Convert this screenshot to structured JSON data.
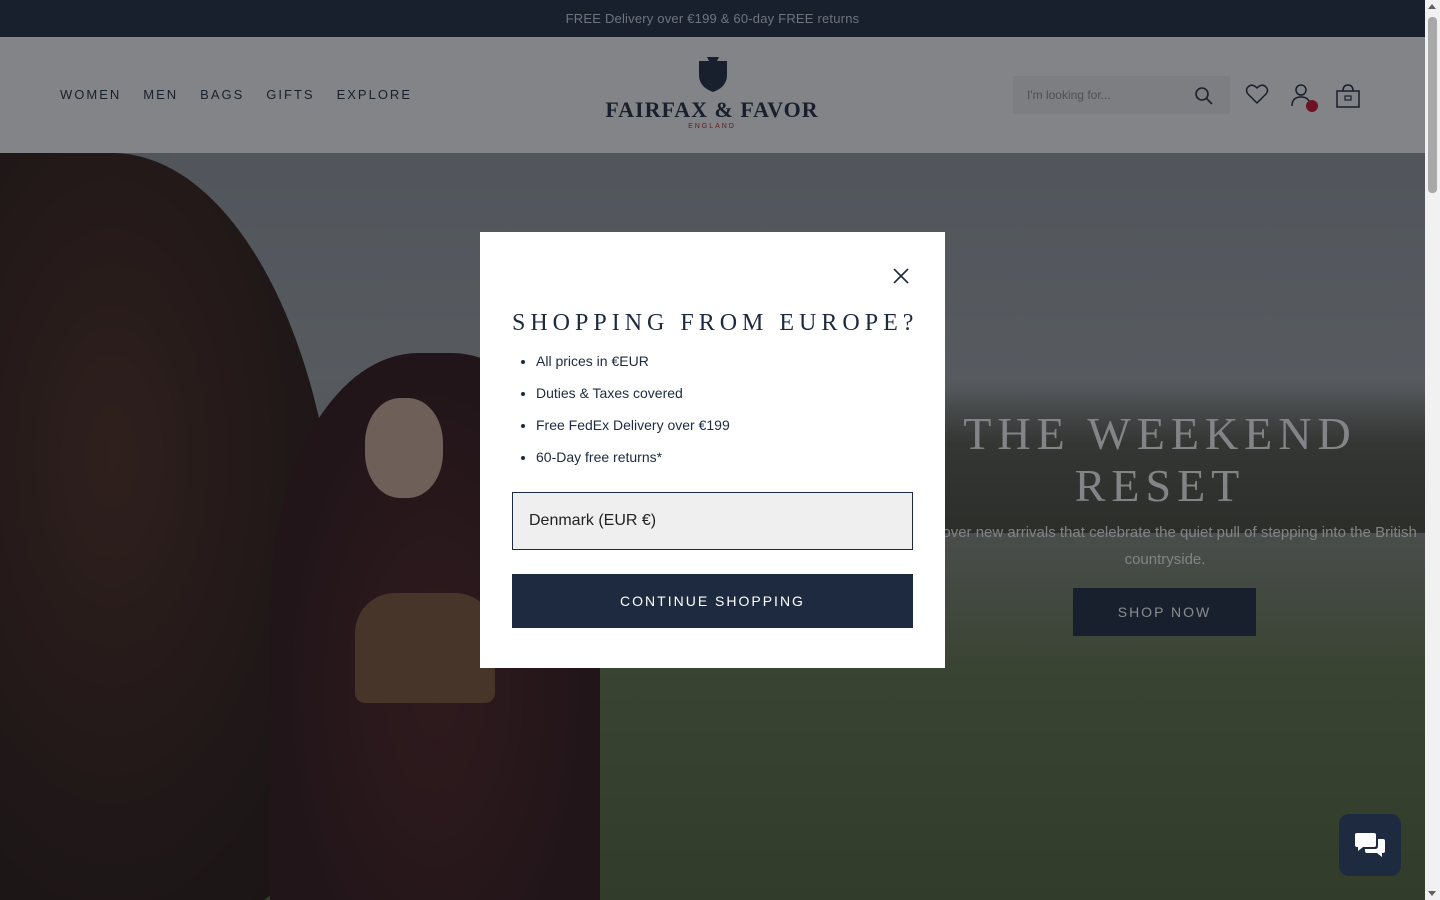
{
  "announcement": {
    "text": "FREE Delivery over €199 & 60-day FREE returns"
  },
  "header": {
    "nav": [
      "WOMEN",
      "MEN",
      "BAGS",
      "GIFTS",
      "EXPLORE"
    ],
    "logo": {
      "name": "FAIRFAX & FAVOR",
      "sub": "ENGLAND"
    },
    "search": {
      "placeholder": "I'm looking for..."
    },
    "icons": [
      "search-icon",
      "heart-icon",
      "account-icon",
      "bag-icon"
    ],
    "account_badge_color": "#c8102e"
  },
  "hero": {
    "title": "THE WEEKEND RESET",
    "subtitle": "Discover new arrivals that celebrate the quiet pull of stepping into the British countryside.",
    "cta": "SHOP NOW"
  },
  "modal": {
    "title": "SHOPPING FROM EUROPE?",
    "bullets": [
      "All prices in €EUR",
      "Duties & Taxes covered",
      "Free FedEx Delivery over €199",
      "60-Day free returns*"
    ],
    "country_select": {
      "selected": "Denmark (EUR €)"
    },
    "continue_label": "CONTINUE SHOPPING"
  },
  "chat": {
    "icon": "chat-icon"
  },
  "colors": {
    "brand_navy": "#1d2a40",
    "badge_red": "#c8102e"
  }
}
